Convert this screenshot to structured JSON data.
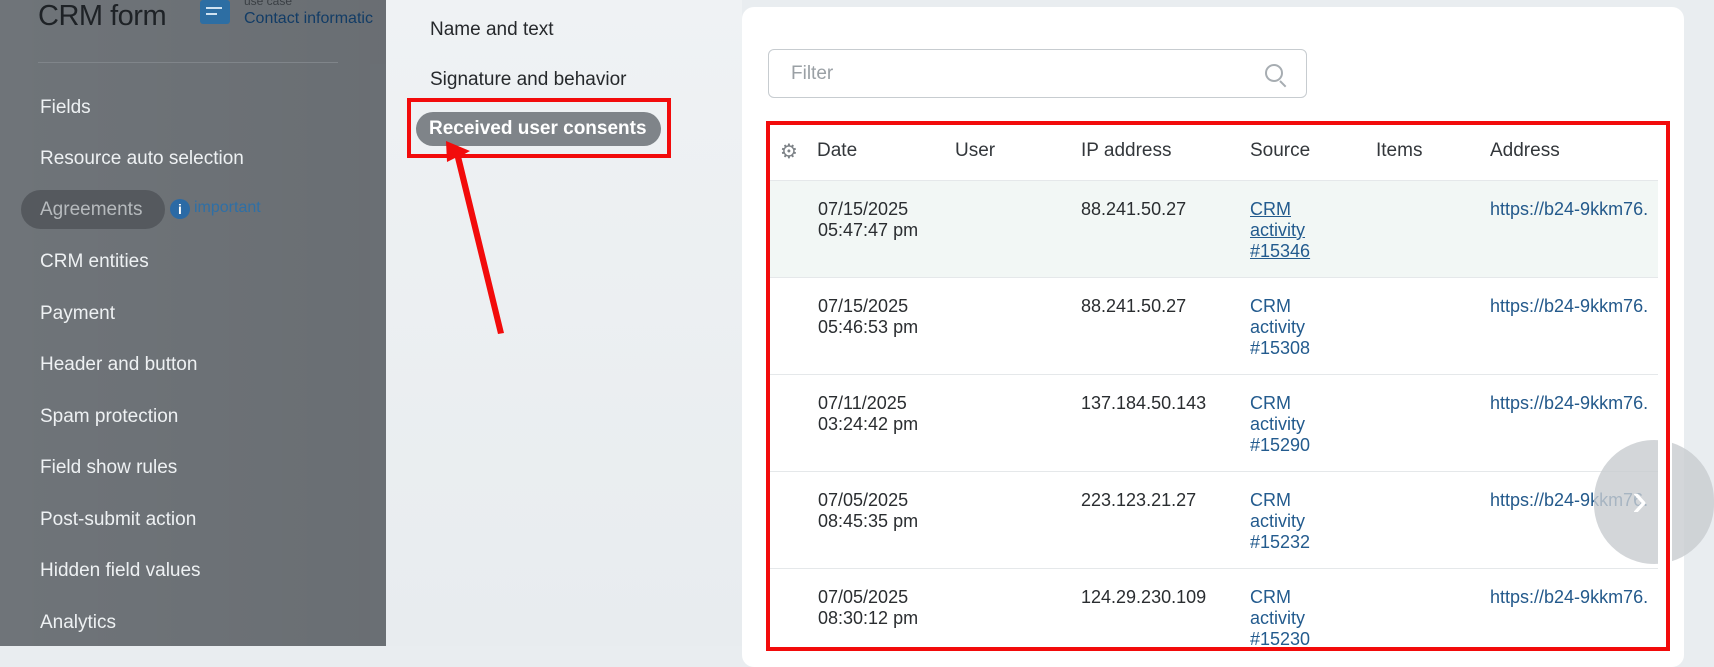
{
  "header": {
    "app_title": "CRM form",
    "use_case_label": "use case",
    "use_case_link": "Contact informatic"
  },
  "sidebar": {
    "items": [
      {
        "label": "Fields"
      },
      {
        "label": "Resource auto selection"
      },
      {
        "label": "Agreements"
      },
      {
        "label": "CRM entities"
      },
      {
        "label": "Payment"
      },
      {
        "label": "Header and button"
      },
      {
        "label": "Spam protection"
      },
      {
        "label": "Field show rules"
      },
      {
        "label": "Post-submit action"
      },
      {
        "label": "Hidden field values"
      },
      {
        "label": "Analytics"
      }
    ],
    "agreements_info_link": "important",
    "info_icon_glyph": "i"
  },
  "subnav": {
    "items": [
      {
        "label": "Name and text"
      },
      {
        "label": "Signature and behavior"
      },
      {
        "label": "Received user consents"
      }
    ]
  },
  "filter": {
    "placeholder": "Filter"
  },
  "table": {
    "columns": [
      "Date",
      "User",
      "IP address",
      "Source",
      "Items",
      "Address"
    ],
    "rows": [
      {
        "date": "07/15/2025 05:47:47 pm",
        "user": "",
        "ip": "88.241.50.27",
        "source": "CRM activity #15346",
        "items": "",
        "address": "https://b24-9kkm76."
      },
      {
        "date": "07/15/2025 05:46:53 pm",
        "user": "",
        "ip": "88.241.50.27",
        "source": "CRM activity #15308",
        "items": "",
        "address": "https://b24-9kkm76."
      },
      {
        "date": "07/11/2025 03:24:42 pm",
        "user": "",
        "ip": "137.184.50.143",
        "source": "CRM activity #15290",
        "items": "",
        "address": "https://b24-9kkm76."
      },
      {
        "date": "07/05/2025 08:45:35 pm",
        "user": "",
        "ip": "223.123.21.27",
        "source": "CRM activity #15232",
        "items": "",
        "address": "https://b24-9kkm76."
      },
      {
        "date": "07/05/2025 08:30:12 pm",
        "user": "",
        "ip": "124.29.230.109",
        "source": "CRM activity #15230",
        "items": "",
        "address": "https://b24-9kkm76."
      }
    ]
  },
  "icons": {
    "gear": "gear-icon",
    "search": "search-icon",
    "next": "chevron-right-icon"
  },
  "colors": {
    "highlight": "#f20b0b",
    "link": "#235b8e",
    "sidebar_bg": "#6f7479"
  }
}
